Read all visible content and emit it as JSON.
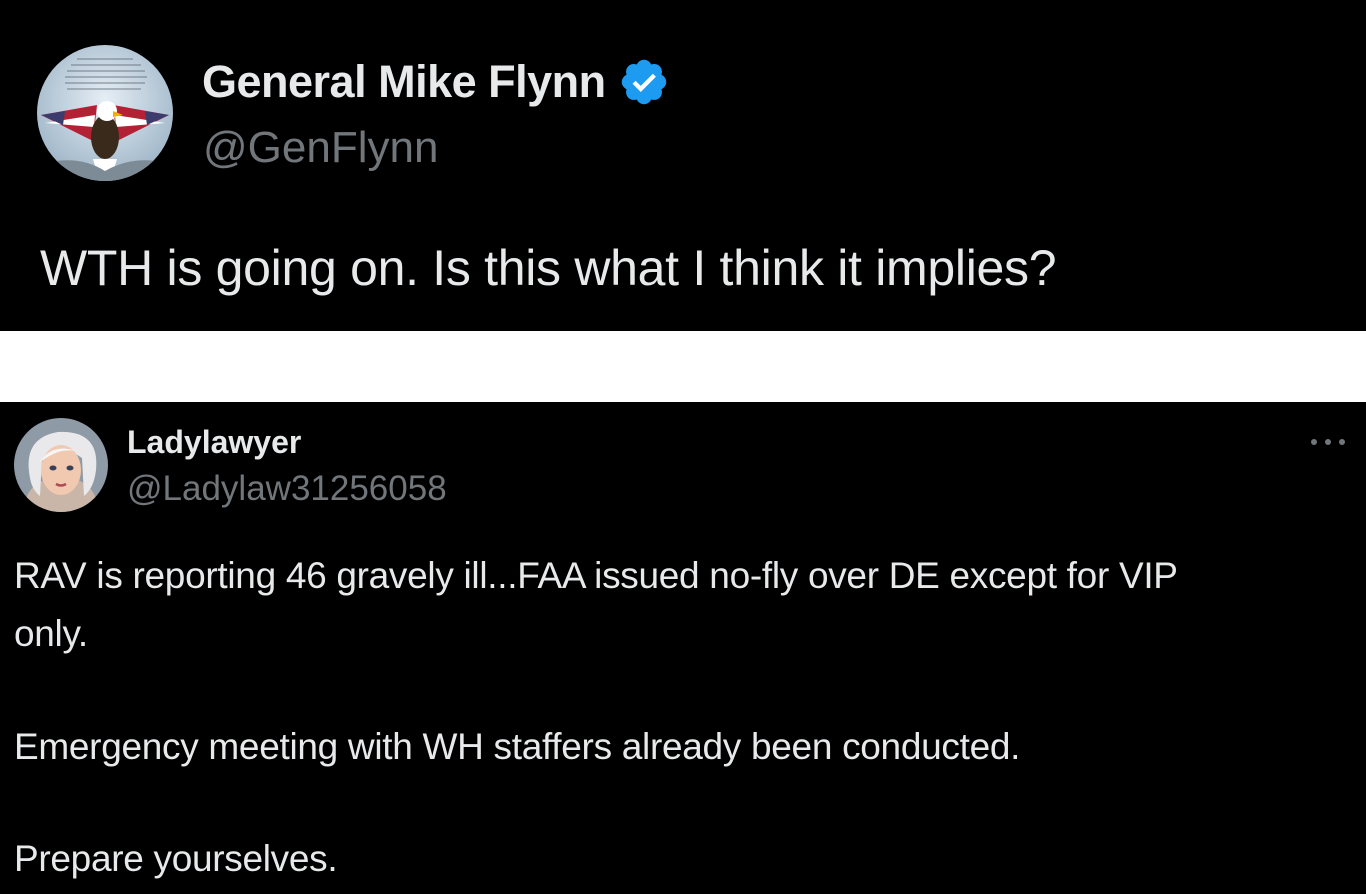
{
  "tweet_top": {
    "display_name": "General Mike Flynn",
    "handle": "@GenFlynn",
    "verified": true,
    "verified_icon": "verified-badge-icon",
    "avatar_icon": "eagle-flag-avatar",
    "text": "WTH is going on. Is this what I think it implies?"
  },
  "tweet_bottom": {
    "display_name": "Ladylawyer",
    "handle": "@Ladylaw31256058",
    "avatar_icon": "woman-portrait-avatar",
    "more_icon": "more-options-icon",
    "lines": [
      "RAV is reporting 46 gravely ill...FAA issued no-fly over DE except for VIP",
      "only.",
      "Emergency meeting with WH staffers already been conducted.",
      "Prepare yourselves."
    ]
  },
  "colors": {
    "background": "#000000",
    "separator": "#ffffff",
    "primary_text": "#e7e9ea",
    "secondary_text": "#71767b",
    "verified_blue": "#1d9bf0"
  }
}
